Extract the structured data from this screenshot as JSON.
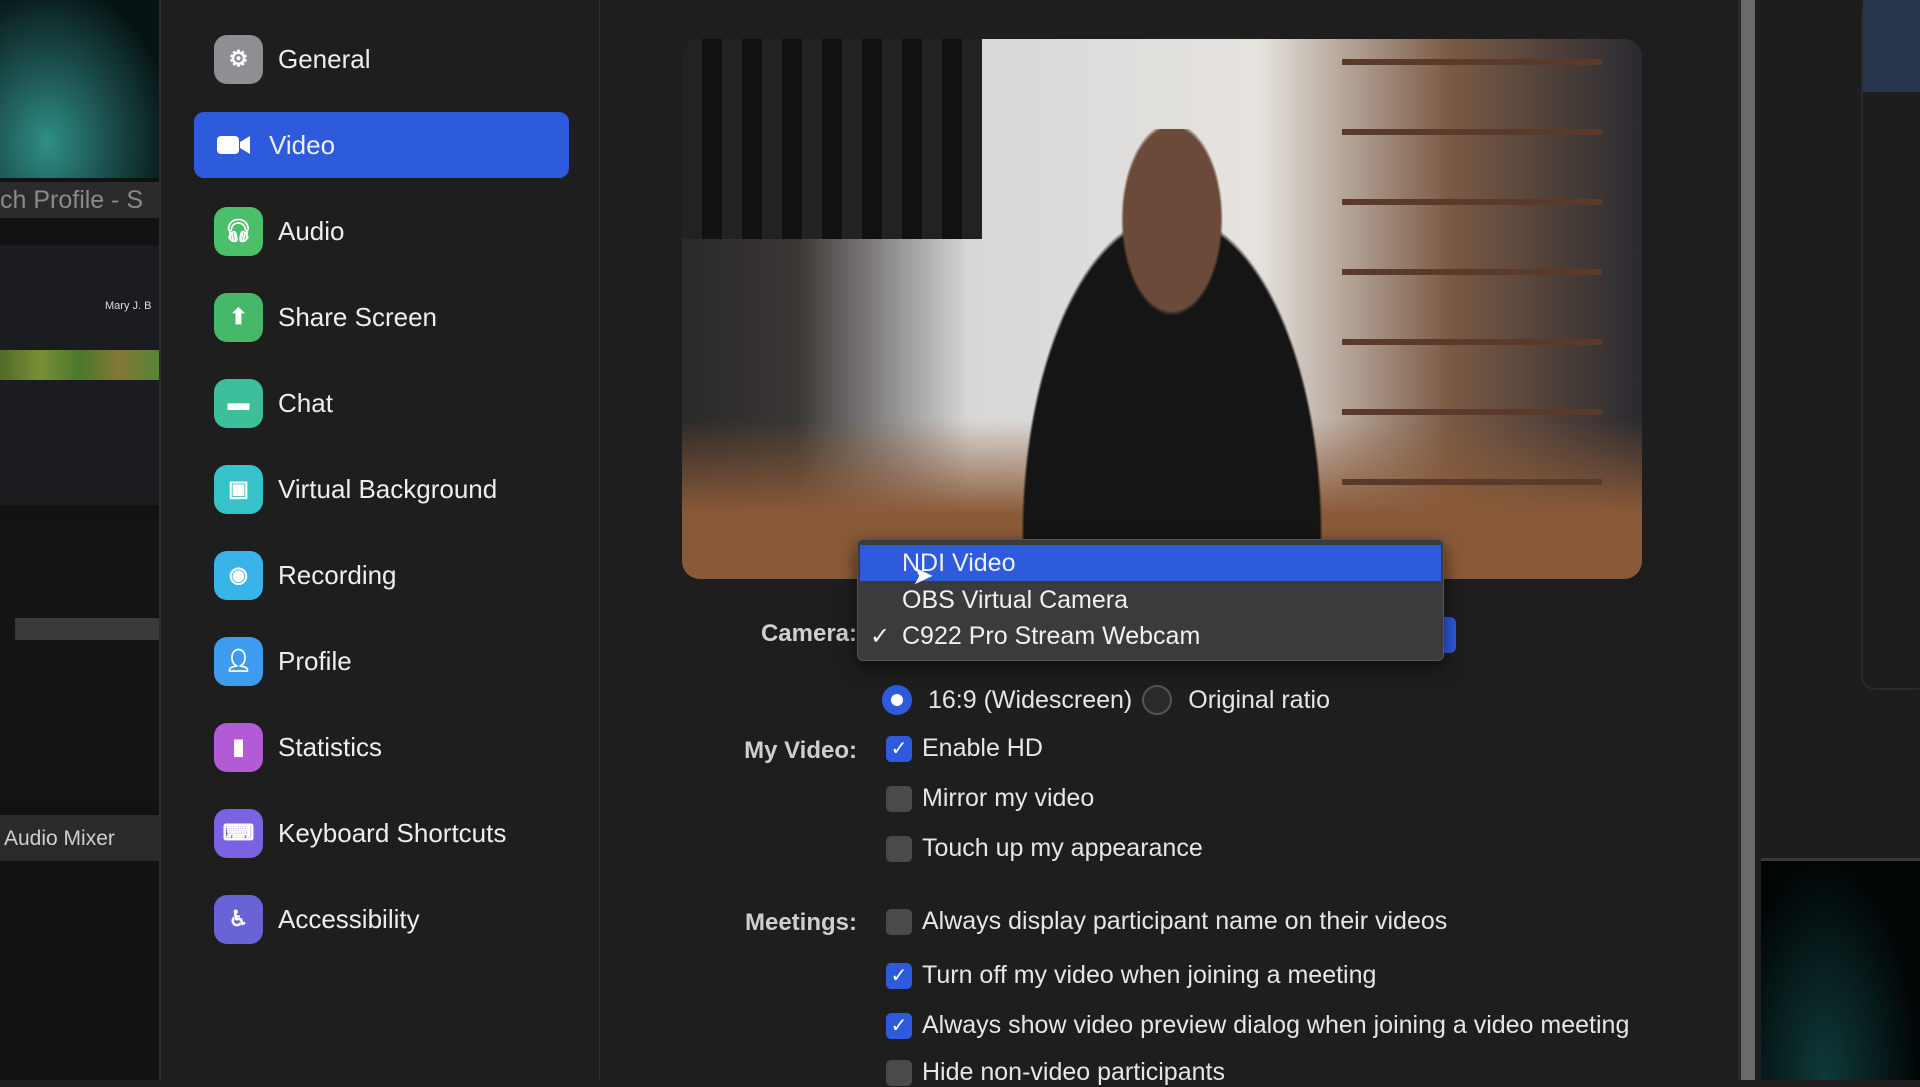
{
  "background_app": {
    "title_fragment": "ch Profile - S",
    "deck_track": "Mary J. B",
    "mixer_label": "Audio Mixer"
  },
  "sidebar": {
    "items": [
      {
        "label": "General",
        "icon": "gear-icon",
        "color": "#8e8e93"
      },
      {
        "label": "Video",
        "icon": "video-camera-icon",
        "color": "#2d5bdc",
        "active": true
      },
      {
        "label": "Audio",
        "icon": "headphones-icon",
        "color": "#4cbf6a"
      },
      {
        "label": "Share Screen",
        "icon": "share-screen-icon",
        "color": "#45b86a"
      },
      {
        "label": "Chat",
        "icon": "chat-bubble-icon",
        "color": "#3cbf9a"
      },
      {
        "label": "Virtual Background",
        "icon": "person-background-icon",
        "color": "#35c2c8"
      },
      {
        "label": "Recording",
        "icon": "record-icon",
        "color": "#38b4e8"
      },
      {
        "label": "Profile",
        "icon": "person-icon",
        "color": "#3d9bf0"
      },
      {
        "label": "Statistics",
        "icon": "bar-chart-icon",
        "color": "#b35ad6"
      },
      {
        "label": "Keyboard Shortcuts",
        "icon": "keyboard-icon",
        "color": "#7a62e0"
      },
      {
        "label": "Accessibility",
        "icon": "accessibility-icon",
        "color": "#6a63d8"
      }
    ]
  },
  "camera": {
    "label": "Camera:",
    "options": [
      {
        "label": "NDI Video",
        "highlighted": true,
        "checked": false
      },
      {
        "label": "OBS Virtual Camera",
        "highlighted": false,
        "checked": false
      },
      {
        "label": "C922 Pro Stream Webcam",
        "highlighted": false,
        "checked": true
      }
    ],
    "check_mark": "✓"
  },
  "ratio": {
    "options": [
      {
        "label": "16:9 (Widescreen)",
        "selected": true
      },
      {
        "label": "Original ratio",
        "selected": false
      }
    ]
  },
  "my_video": {
    "label": "My Video:",
    "options": [
      {
        "label": "Enable HD",
        "checked": true
      },
      {
        "label": "Mirror my video",
        "checked": false
      },
      {
        "label": "Touch up my appearance",
        "checked": false
      }
    ]
  },
  "meetings": {
    "label": "Meetings:",
    "options": [
      {
        "label": "Always display participant name on their videos",
        "checked": false
      },
      {
        "label": "Turn off my video when joining a meeting",
        "checked": true
      },
      {
        "label": "Always show video preview dialog when joining a video meeting",
        "checked": true
      },
      {
        "label": "Hide non-video participants",
        "checked": false
      }
    ]
  },
  "accent_color": "#2d5bdc"
}
